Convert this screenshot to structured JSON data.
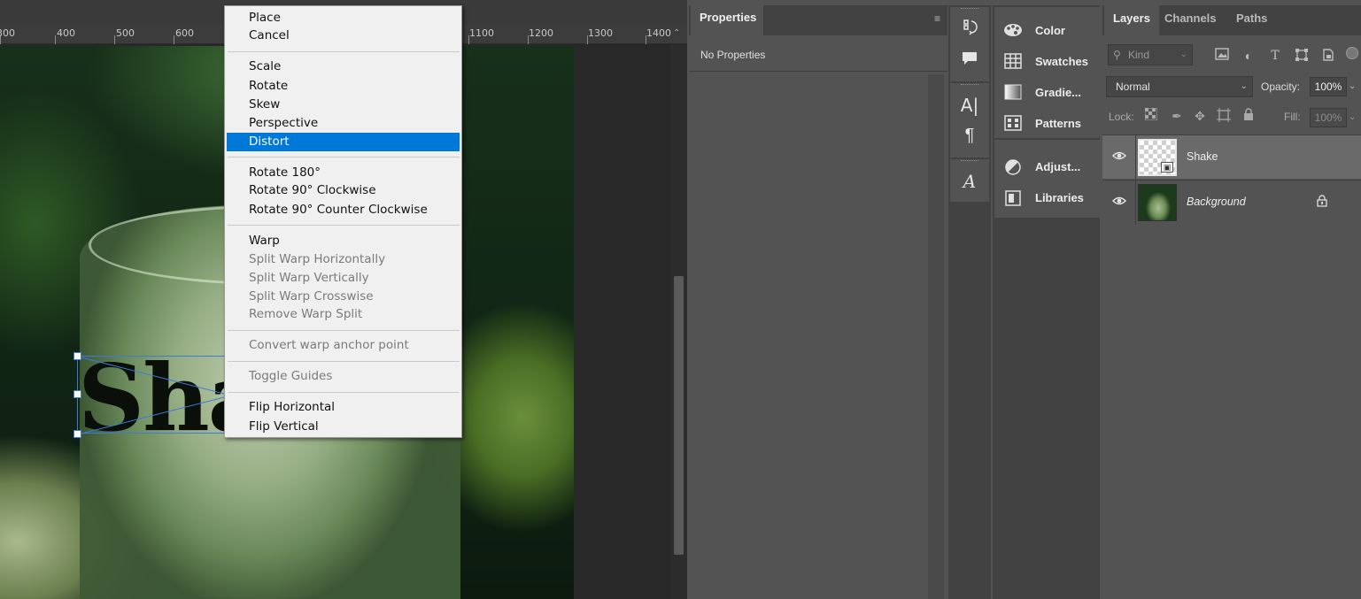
{
  "ruler": {
    "labels": [
      "300",
      "400",
      "500",
      "600",
      "1100",
      "1200",
      "1300",
      "1400"
    ]
  },
  "canvas": {
    "text_layer_content": "Shake"
  },
  "context_menu": {
    "items": [
      {
        "label": "Place",
        "enabled": true
      },
      {
        "label": "Cancel",
        "enabled": true
      },
      {
        "label": "Scale",
        "enabled": true
      },
      {
        "label": "Rotate",
        "enabled": true
      },
      {
        "label": "Skew",
        "enabled": true
      },
      {
        "label": "Perspective",
        "enabled": true
      },
      {
        "label": "Distort",
        "enabled": true,
        "highlighted": true
      },
      {
        "label": "Rotate 180°",
        "enabled": true
      },
      {
        "label": "Rotate 90° Clockwise",
        "enabled": true
      },
      {
        "label": "Rotate 90° Counter Clockwise",
        "enabled": true
      },
      {
        "label": "Warp",
        "enabled": true
      },
      {
        "label": "Split Warp Horizontally",
        "enabled": false
      },
      {
        "label": "Split Warp Vertically",
        "enabled": false
      },
      {
        "label": "Split Warp Crosswise",
        "enabled": false
      },
      {
        "label": "Remove Warp Split",
        "enabled": false
      },
      {
        "label": "Convert warp anchor point",
        "enabled": false
      },
      {
        "label": "Toggle Guides",
        "enabled": false
      },
      {
        "label": "Flip Horizontal",
        "enabled": true
      },
      {
        "label": "Flip Vertical",
        "enabled": true
      }
    ],
    "highlight_color": "#0078d7"
  },
  "properties_panel": {
    "tab_label": "Properties",
    "message": "No Properties"
  },
  "tool_column": {
    "icons": [
      "history-icon",
      "comment-icon",
      "character-icon",
      "paragraph-icon",
      "glyphs-icon"
    ]
  },
  "quick_panels": {
    "groups": [
      [
        {
          "label": "Color",
          "icon": "palette-icon"
        },
        {
          "label": "Swatches",
          "icon": "swatches-icon"
        },
        {
          "label": "Gradie...",
          "icon": "gradient-icon"
        },
        {
          "label": "Patterns",
          "icon": "patterns-icon"
        }
      ],
      [
        {
          "label": "Adjust...",
          "icon": "adjustments-icon"
        },
        {
          "label": "Libraries",
          "icon": "libraries-icon"
        }
      ]
    ]
  },
  "layers_panel": {
    "tabs": [
      {
        "label": "Layers",
        "active": true
      },
      {
        "label": "Channels",
        "active": false
      },
      {
        "label": "Paths",
        "active": false
      }
    ],
    "filter": {
      "kind_placeholder": "Kind"
    },
    "blend_mode": "Normal",
    "opacity_label": "Opacity:",
    "opacity_value": "100%",
    "lock_label": "Lock:",
    "fill_label": "Fill:",
    "fill_value": "100%",
    "layers": [
      {
        "name": "Shake",
        "selected": true,
        "locked": false,
        "italic": false
      },
      {
        "name": "Background",
        "selected": false,
        "locked": true,
        "italic": true
      }
    ]
  }
}
